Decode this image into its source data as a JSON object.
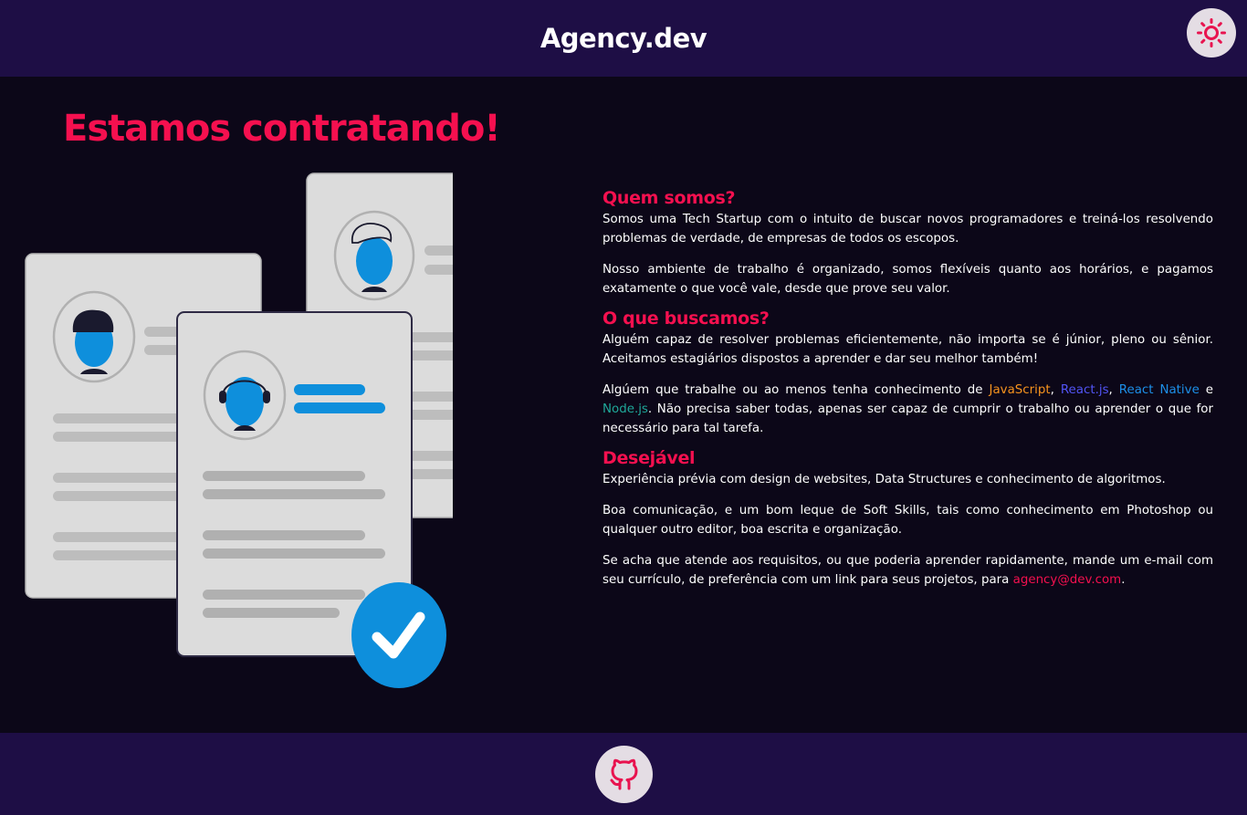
{
  "header": {
    "brand": "Agency.dev",
    "theme_toggle_icon": "sun-icon"
  },
  "hero": {
    "title": "Estamos contratando!",
    "illustration_icon": "resume-documents-illustration"
  },
  "sections": {
    "about": {
      "title": "Quem somos?",
      "p1": "Somos uma Tech Startup com o intuito de buscar novos programadores e treiná-los resolvendo problemas de verdade, de empresas de todos os escopos.",
      "p2": "Nosso ambiente de trabalho é organizado, somos flexíveis quanto aos horários, e pagamos exatamente o que você vale, desde que prove seu valor."
    },
    "seeking": {
      "title": "O que buscamos?",
      "p1": "Alguém capaz de resolver problemas eficientemente, não importa se é júnior, pleno ou sênior. Aceitamos estagiários dispostos a aprender e dar seu melhor também!",
      "p2_prefix": "Algúem que trabalhe ou ao menos tenha conhecimento de ",
      "tech_javascript": "JavaScript",
      "sep1": ", ",
      "tech_react": "React.js",
      "sep2": ", ",
      "tech_react_native": "React Native",
      "sep3": " e ",
      "tech_node": "Node.js",
      "p2_suffix": ". Não precisa saber todas, apenas ser capaz de cumprir o trabalho ou aprender o que for necessário para tal tarefa."
    },
    "desirable": {
      "title": "Desejável",
      "p1": "Experiência prévia com design de websites, Data Structures e conhecimento de algoritmos.",
      "p2": "Boa comunicação, e um bom leque de Soft Skills, tais como conhecimento em Photoshop ou qualquer outro editor, boa escrita e organização.",
      "p3_prefix": "Se acha que atende aos requisitos, ou que poderia aprender rapidamente, mande um e-mail com seu currículo, de preferência com um link para seus projetos, para ",
      "email": "agency@dev.com",
      "p3_suffix": "."
    }
  },
  "footer": {
    "github_icon": "github-icon"
  },
  "colors": {
    "accent": "#f5104f",
    "header_bg": "#1e0e45",
    "page_bg": "#0c0718",
    "javascript": "#f7931e",
    "react": "#5254f5",
    "react_native": "#1d8fe8",
    "node": "#1fa89a",
    "illustration_blue": "#0e8fdc"
  }
}
